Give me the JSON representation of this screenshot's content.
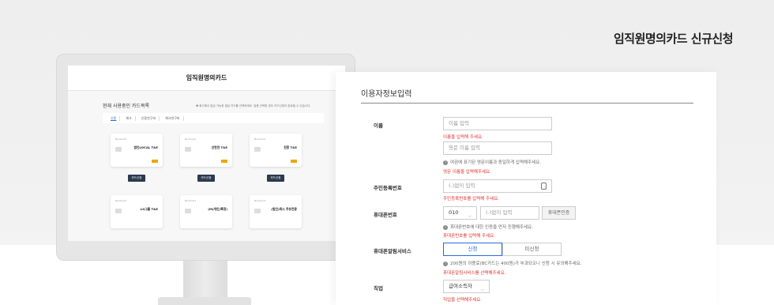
{
  "hero": {
    "title": "임직원명의카드 신규신청"
  },
  "monitor": {
    "screen_title": "임직원명의카드",
    "section_title": "현재 사용중인 카드목록",
    "notice": "❶ 회사에서 발급 가능한 발급 카드를 선택하세요. 일용 선택한 경우 카드신청이 완료될 수 있습니다.",
    "tabs": [
      "신용",
      "체크",
      "신용연구비",
      "체크연구비"
    ],
    "cards": [
      {
        "brand": "Nookcard",
        "name": "법인LOCAL T&E"
      },
      {
        "brand": "Nookcard",
        "name": "선한연 T&E"
      },
      {
        "brand": "Nookcard",
        "name": "친환 T&E"
      },
      {
        "brand": "Nookcard",
        "name": "LG그룹 T&E"
      },
      {
        "brand": "Nookcard",
        "name": "(M)개인(특정)"
      },
      {
        "brand": "Nookcard",
        "name": "(법인)독스 주유전용"
      }
    ],
    "card_button": "카드신청"
  },
  "form": {
    "section_title": "이용자정보입력",
    "name": {
      "label": "이름",
      "placeholder": "이름 입력",
      "error": "이름을 입력해 주세요.",
      "en_placeholder": "영문 이름 입력",
      "en_hint": "여권에 표기된 영문이름과 동일하게 입력해주세요.",
      "en_error": "영문 이름을 입력해주세요."
    },
    "rrn": {
      "label": "주민등록번호",
      "placeholder": "(-)없이 입력",
      "error": "주민등록번호를 입력해 주세요."
    },
    "phone": {
      "label": "휴대폰번호",
      "prefix": "010",
      "placeholder": "(-)없이 입력",
      "verify_button": "휴대폰인증",
      "hint": "휴대폰번호에 대한 인증을 먼저 진행해주세요.",
      "error": "휴대폰번호를 입력해 주세요."
    },
    "sms": {
      "label": "휴대폰알림서비스",
      "options": [
        "신청",
        "미신청"
      ],
      "hint": "200원의 이용료(BC카드는 400원)가 부과되오니 신청 시 유의해주세요.",
      "error": "휴대폰알림서비스를 선택해주세요."
    },
    "job": {
      "label": "직업",
      "value": "급여소득자",
      "error": "직업을 선택해주세요."
    }
  }
}
